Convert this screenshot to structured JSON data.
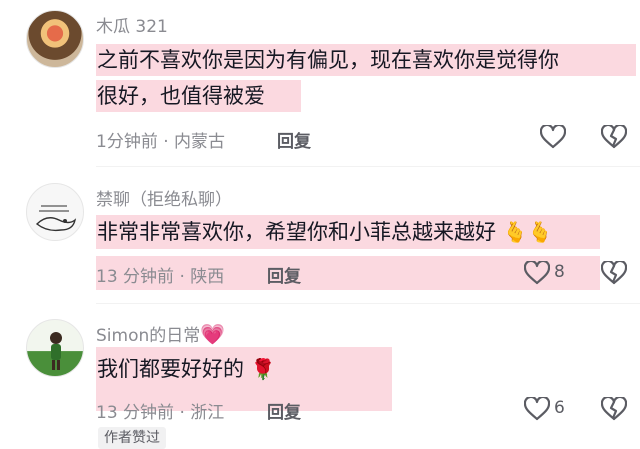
{
  "comments": [
    {
      "username": "木瓜 321",
      "lines": [
        "之前不喜欢你是因为有偏见，现在喜欢你是觉得你",
        "很好，也值得被爱"
      ],
      "meta": "1分钟前 · 内蒙古",
      "reply_label": "回复",
      "like_count": ""
    },
    {
      "username": "禁聊（拒绝私聊）",
      "lines": [
        "非常非常喜欢你，希望你和小菲总越来越好"
      ],
      "emojis": "🫰🫰",
      "meta": "13 分钟前 · 陕西",
      "reply_label": "回复",
      "like_count": "8"
    },
    {
      "username": "Simon的日常",
      "username_emoji": "💗",
      "lines": [
        "我们都要好好的"
      ],
      "emojis": "🌹",
      "meta": "13 分钟前 · 浙江",
      "reply_label": "回复",
      "like_count": "6",
      "author_badge": "作者赞过"
    }
  ],
  "icons": {
    "like": "heart-outline-icon",
    "dislike": "broken-heart-icon"
  },
  "colors": {
    "highlight": "#fbd9e0",
    "meta_text": "#8a8b91",
    "body_text": "#161823"
  }
}
